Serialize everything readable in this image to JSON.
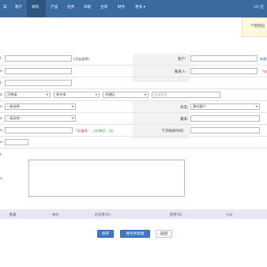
{
  "nav": {
    "items": [
      {
        "label": "菜"
      },
      {
        "label": "客户"
      },
      {
        "label": "商机"
      },
      {
        "label": "产品"
      },
      {
        "label": "任务"
      },
      {
        "label": "日程"
      },
      {
        "label": "合同"
      },
      {
        "label": "财务"
      },
      {
        "label": "更多 ▾"
      }
    ],
    "right": "[2] 在"
  },
  "notice": "个新短信",
  "form": {
    "r1": {
      "left_label": "l:",
      "left_hint": "(点击选择)",
      "right_label": "客户:",
      "right_link": "新建"
    },
    "r2": {
      "left_label": "s:",
      "right_label": "联系人:",
      "right_req": "*必"
    },
    "r3": {
      "left_label": "l:"
    },
    "r4": {
      "left_label": "s:",
      "province": "河南省",
      "city": "郑州市",
      "district": "市辖区",
      "detail_placeholder": "街道信息"
    },
    "r5": {
      "left_label": "s:",
      "left_select": "--请选择--",
      "right_label": "状态:",
      "right_select": "意向客户"
    },
    "r6": {
      "left_label": "s:",
      "left_select": "--请选择--",
      "right_label": "赢率:"
    },
    "r7": {
      "left_label": "s:",
      "req": "*必填项",
      "unit": "(元/单位：元)",
      "right_label": "下次联系时间:"
    },
    "r8": {
      "left_label": "s:"
    },
    "r9": {
      "left_label": "l:"
    },
    "r10": {
      "left_label": "s:"
    }
  },
  "table": {
    "headers": [
      "数量",
      "单价",
      "折扣率(%)",
      "税率(%)",
      "小计"
    ]
  },
  "buttons": {
    "save": "保存",
    "save_new": "保存并新建",
    "back": "返回"
  }
}
